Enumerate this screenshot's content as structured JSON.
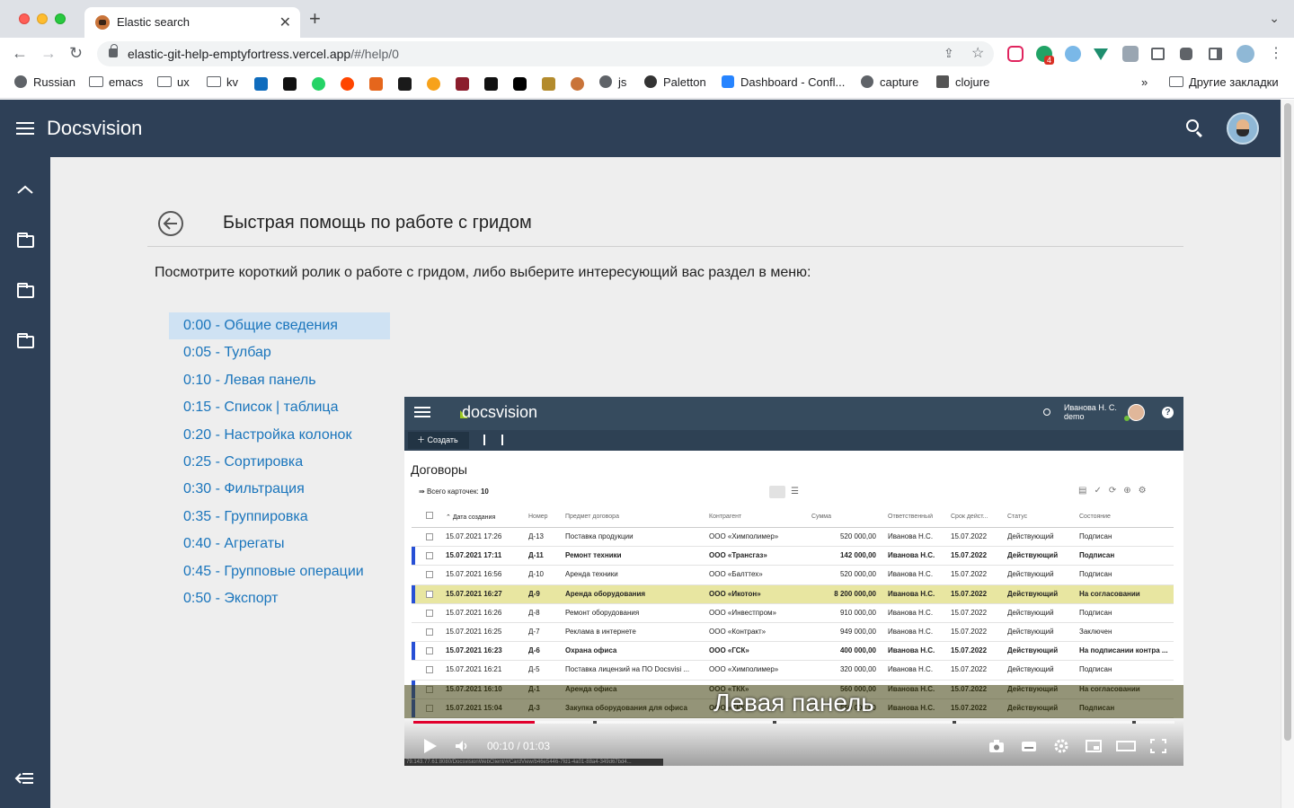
{
  "browser": {
    "tab_title": "Elastic search",
    "url_host": "elastic-git-help-emptyfortress.vercel.app",
    "url_path": "/#/help/0",
    "bookmarks": [
      "Russian",
      "emacs",
      "ux",
      "kv",
      "js",
      "Paletton",
      "Dashboard - Confl...",
      "capture",
      "clojure"
    ],
    "other_bookmarks": "Другие закладки",
    "ext_badge": "4"
  },
  "app": {
    "title": "Docsvision"
  },
  "page": {
    "title": "Быстрая помощь по работе с гридом",
    "intro": "Посмотрите короткий ролик о работе с гридом, либо выберите интересующий вас раздел в меню:",
    "chapters": [
      "0:00 - Общие сведения",
      "0:05 - Тулбар",
      "0:10 - Левая панель",
      "0:15 - Список | таблица",
      "0:20 - Настройка колонок",
      "0:25 - Сортировка",
      "0:30 - Фильтрация",
      "0:35 - Группировка",
      "0:40 - Агрегаты",
      "0:45 - Групповые операции",
      "0:50 - Экспорт"
    ],
    "active_chapter": 0
  },
  "video": {
    "logo": "docsvision",
    "user_name": "Иванова Н. С.",
    "user_role": "demo",
    "help": "?",
    "create_label": "Создать",
    "section_title": "Договоры",
    "count_label": "Всего карточек:",
    "count_value": "10",
    "columns": [
      "Дата создания",
      "Номер",
      "Предмет договора",
      "Контрагент",
      "Сумма",
      "Ответственный",
      "Срок дейст...",
      "Статус",
      "Состояние"
    ],
    "rows": [
      {
        "date": "15.07.2021 17:26",
        "num": "Д-13",
        "subject": "Поставка продукции",
        "party": "ООО «Химполимер»",
        "sum": "520 000,00",
        "resp": "Иванова Н.С.",
        "term": "15.07.2022",
        "status": "Действующий",
        "state": "Подписан",
        "bold": false,
        "marked": false,
        "hl": false
      },
      {
        "date": "15.07.2021 17:11",
        "num": "Д-11",
        "subject": "Ремонт техники",
        "party": "ООО «Трансгаз»",
        "sum": "142 000,00",
        "resp": "Иванова Н.С.",
        "term": "15.07.2022",
        "status": "Действующий",
        "state": "Подписан",
        "bold": true,
        "marked": true,
        "hl": false
      },
      {
        "date": "15.07.2021 16:56",
        "num": "Д-10",
        "subject": "Аренда техники",
        "party": "ООО «Балттех»",
        "sum": "520 000,00",
        "resp": "Иванова Н.С.",
        "term": "15.07.2022",
        "status": "Действующий",
        "state": "Подписан",
        "bold": false,
        "marked": false,
        "hl": false
      },
      {
        "date": "15.07.2021 16:27",
        "num": "Д-9",
        "subject": "Аренда оборудования",
        "party": "ООО «Икотон»",
        "sum": "8 200 000,00",
        "resp": "Иванова Н.С.",
        "term": "15.07.2022",
        "status": "Действующий",
        "state": "На согласовании",
        "bold": true,
        "marked": true,
        "hl": true
      },
      {
        "date": "15.07.2021 16:26",
        "num": "Д-8",
        "subject": "Ремонт оборудования",
        "party": "ООО «Инвестпром»",
        "sum": "910 000,00",
        "resp": "Иванова Н.С.",
        "term": "15.07.2022",
        "status": "Действующий",
        "state": "Подписан",
        "bold": false,
        "marked": false,
        "hl": false
      },
      {
        "date": "15.07.2021 16:25",
        "num": "Д-7",
        "subject": "Реклама в интернете",
        "party": "ООО «Контракт»",
        "sum": "949 000,00",
        "resp": "Иванова Н.С.",
        "term": "15.07.2022",
        "status": "Действующий",
        "state": "Заключен",
        "bold": false,
        "marked": false,
        "hl": false
      },
      {
        "date": "15.07.2021 16:23",
        "num": "Д-6",
        "subject": "Охрана офиса",
        "party": "ООО «ГСК»",
        "sum": "400 000,00",
        "resp": "Иванова Н.С.",
        "term": "15.07.2022",
        "status": "Действующий",
        "state": "На подписании контра ...",
        "bold": true,
        "marked": true,
        "hl": false
      },
      {
        "date": "15.07.2021 16:21",
        "num": "Д-5",
        "subject": "Поставка лицензий на ПО Docsvisi ...",
        "party": "ООО «Химполимер»",
        "sum": "320 000,00",
        "resp": "Иванова Н.С.",
        "term": "15.07.2022",
        "status": "Действующий",
        "state": "Подписан",
        "bold": false,
        "marked": false,
        "hl": false
      },
      {
        "date": "15.07.2021 16:10",
        "num": "Д-1",
        "subject": "Аренда офиса",
        "party": "ООО «ТКК»",
        "sum": "560 000,00",
        "resp": "Иванова Н.С.",
        "term": "15.07.2022",
        "status": "Действующий",
        "state": "На согласовании",
        "bold": true,
        "marked": true,
        "hl": false
      },
      {
        "date": "15.07.2021 15:04",
        "num": "Д-3",
        "subject": "Закупка оборудования для офиса",
        "party": "ООО «ТКК»",
        "sum": "560 000,00",
        "resp": "Иванова Н.С.",
        "term": "15.07.2022",
        "status": "Действующий",
        "state": "Подписан",
        "bold": true,
        "marked": true,
        "hl": false
      }
    ],
    "caption": "Левая панель",
    "time": "00:10 / 01:03",
    "progress": 0.159,
    "status_url": "79.143.77.61:8080/DocsvisionWebClient/#/CardView/b46e5446-7fd1-4a01-88a4-349d67bd4..."
  }
}
